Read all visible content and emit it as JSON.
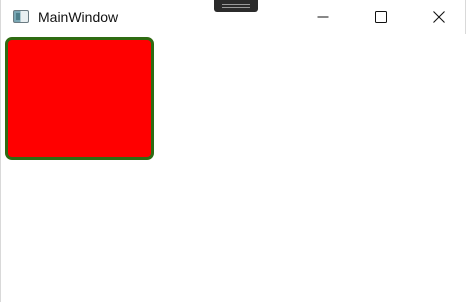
{
  "window": {
    "title": "MainWindow",
    "icons": {
      "app": "app-window-icon",
      "minimize": "minimize-icon",
      "maximize": "maximize-icon",
      "close": "close-icon"
    }
  },
  "content": {
    "shape": {
      "fill_color": "#ff0000",
      "border_color": "#2f6b12"
    }
  }
}
